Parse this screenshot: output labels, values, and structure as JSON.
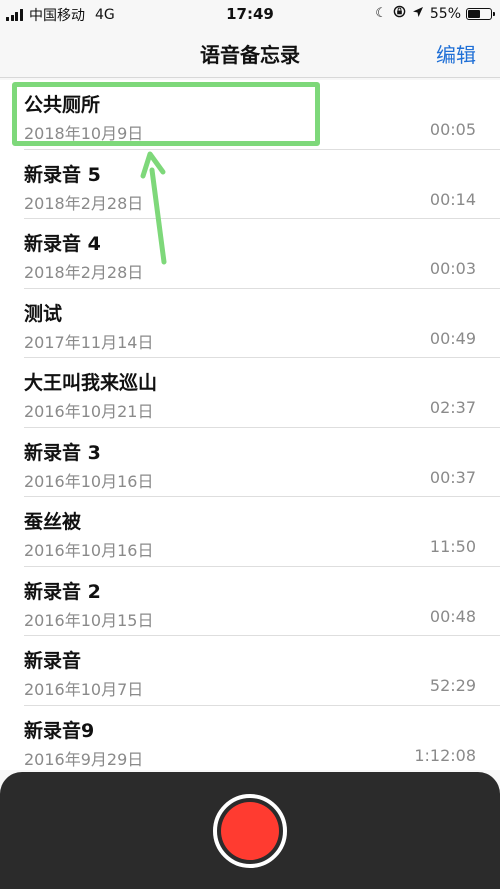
{
  "status_bar": {
    "carrier": "中国移动",
    "network": "4G",
    "time": "17:49",
    "battery_level": "55%",
    "battery_fraction": 0.55
  },
  "nav": {
    "title": "语音备忘录",
    "edit_label": "编辑"
  },
  "recordings": [
    {
      "name": "公共厕所",
      "date": "2018年10月9日",
      "duration": "00:05"
    },
    {
      "name": "新录音 5",
      "date": "2018年2月28日",
      "duration": "00:14"
    },
    {
      "name": "新录音 4",
      "date": "2018年2月28日",
      "duration": "00:03"
    },
    {
      "name": "测试",
      "date": "2017年11月14日",
      "duration": "00:49"
    },
    {
      "name": "大王叫我来巡山",
      "date": "2016年10月21日",
      "duration": "02:37"
    },
    {
      "name": "新录音 3",
      "date": "2016年10月16日",
      "duration": "00:37"
    },
    {
      "name": "蚕丝被",
      "date": "2016年10月16日",
      "duration": "11:50"
    },
    {
      "name": "新录音 2",
      "date": "2016年10月15日",
      "duration": "00:48"
    },
    {
      "name": "新录音",
      "date": "2016年10月7日",
      "duration": "52:29"
    },
    {
      "name": "新录音9",
      "date": "2016年9月29日",
      "duration": "1:12:08"
    }
  ],
  "colors": {
    "accent": "#1f6fd6",
    "record": "#ff3b30",
    "highlight": "#7ed87a",
    "panel": "#2b2b2b"
  },
  "icons": {
    "do_not_disturb": "moon-icon",
    "orientation_lock": "lock-rotation-icon",
    "location": "location-arrow-icon",
    "battery": "battery-icon"
  }
}
